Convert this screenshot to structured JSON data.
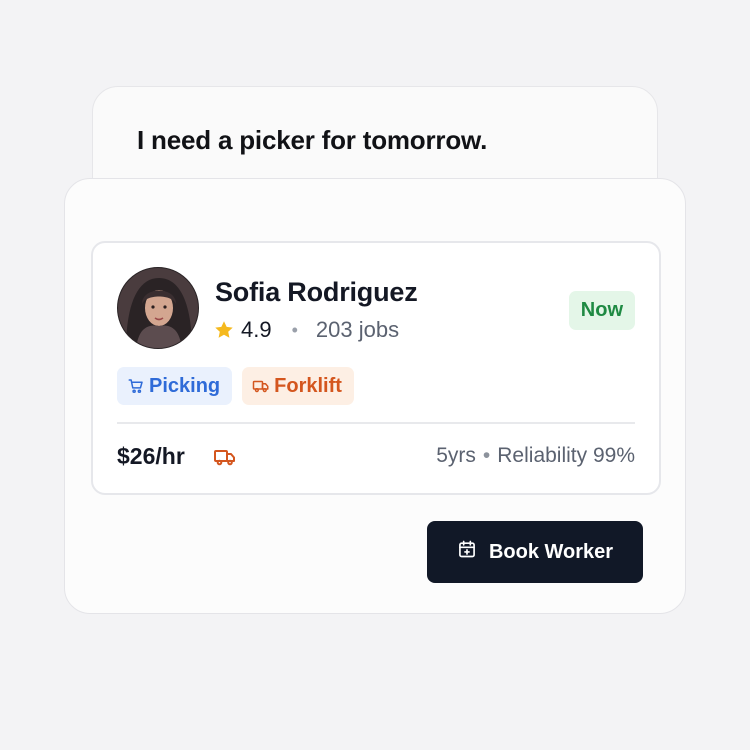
{
  "prompt": {
    "text": "I need a picker for tomorrow."
  },
  "worker": {
    "name": "Sofia Rodriguez",
    "rating": "4.9",
    "rating_icon": "star-icon",
    "separator": "•",
    "jobs": "203 jobs",
    "status": "Now",
    "skills": [
      {
        "label": "Picking",
        "icon": "cart-icon",
        "color": "#2f6bd8"
      },
      {
        "label": "Forklift",
        "icon": "truck-icon",
        "color": "#d4561e"
      }
    ],
    "rate": "$26/hr",
    "experience": "5yrs",
    "stats_separator": "•",
    "reliability": "Reliability 99%"
  },
  "actions": {
    "book_label": "Book Worker",
    "book_icon": "calendar-plus-icon"
  },
  "colors": {
    "accent_dark": "#111827",
    "status_green": "#1f8a43",
    "status_green_bg": "#e4f6e8",
    "star": "#f5b91e",
    "orange": "#d4561e",
    "blue": "#2f6bd8"
  }
}
